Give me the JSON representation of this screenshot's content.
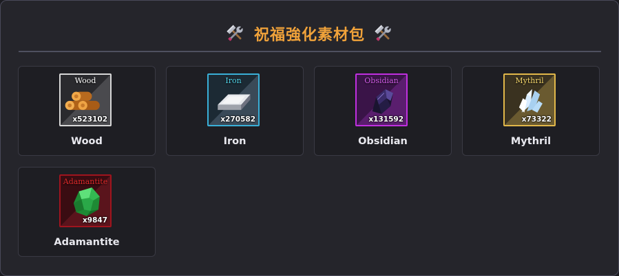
{
  "panel": {
    "title": "祝福強化素材包",
    "title_color": "#f0a23a",
    "title_icon": "hammer-wrench-icon"
  },
  "materials": [
    {
      "name": "Wood",
      "icon_label": "Wood",
      "quantity": "x523102",
      "label_color": "#ffffff",
      "frame_color": "#d8d8d8",
      "icon": "wood-logs-icon"
    },
    {
      "name": "Iron",
      "icon_label": "Iron",
      "quantity": "x270582",
      "label_color": "#4fd3e8",
      "frame_color": "#3ab0d8",
      "icon": "iron-ingot-icon"
    },
    {
      "name": "Obsidian",
      "icon_label": "Obsidian",
      "quantity": "x131592",
      "label_color": "#d15ce8",
      "frame_color": "#c030e0",
      "icon": "obsidian-shard-icon"
    },
    {
      "name": "Mythril",
      "icon_label": "Mythril",
      "quantity": "x73322",
      "label_color": "#f2d46a",
      "frame_color": "#e2b84a",
      "icon": "mythril-crystal-icon"
    },
    {
      "name": "Adamantite",
      "icon_label": "Adamantite",
      "quantity": "x9847",
      "label_color": "#e02a2a",
      "frame_color": "#a0141e",
      "icon": "adamantite-gem-icon"
    }
  ]
}
